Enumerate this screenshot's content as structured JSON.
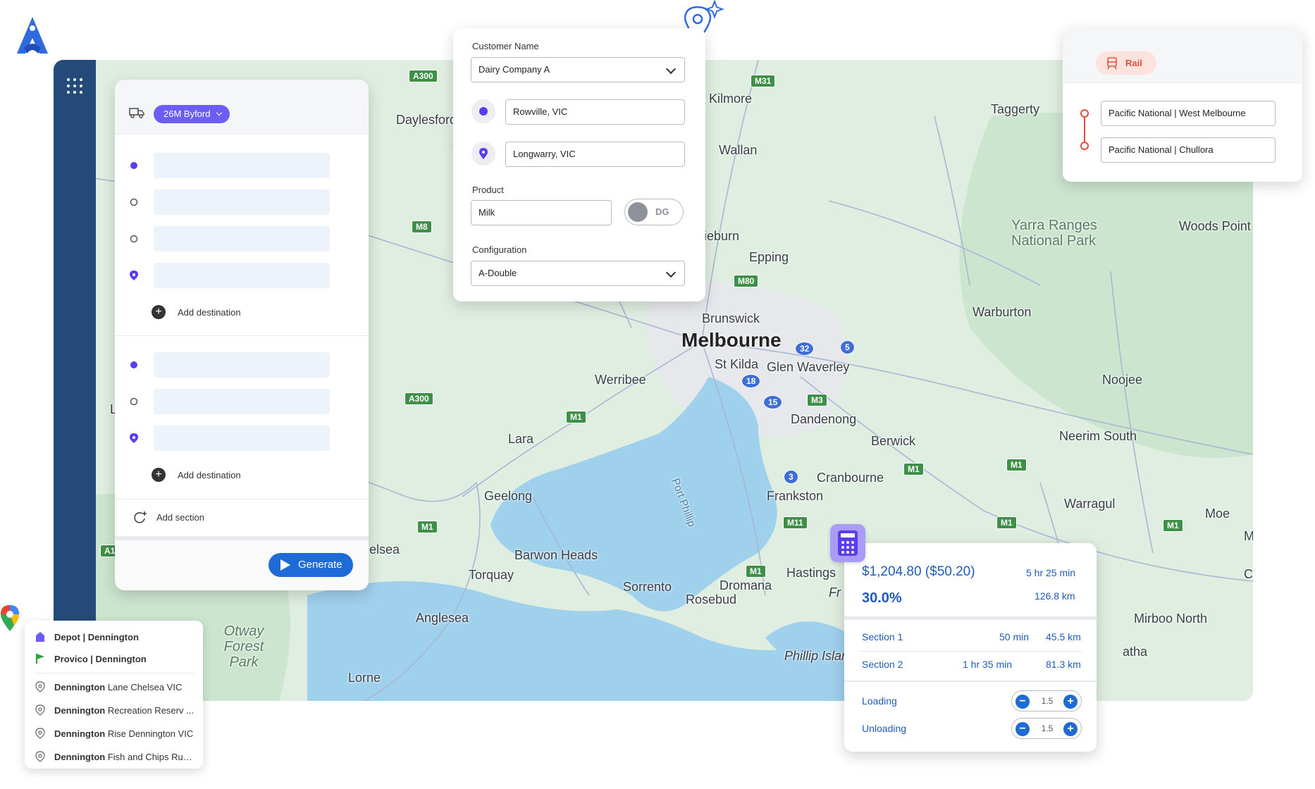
{
  "sidebar": {
    "apps_icon": "grid-dots-icon"
  },
  "route_panel": {
    "vehicle": "26M Byford",
    "add_destination": "Add destination",
    "add_section": "Add section",
    "generate": "Generate"
  },
  "order": {
    "customer_label": "Customer Name",
    "customer_value": "Dairy Company A",
    "origin": "Rowville, VIC",
    "destination": "Longwarry, VIC",
    "product_label": "Product",
    "product_value": "Milk",
    "dg_toggle": "DG",
    "config_label": "Configuration",
    "config_value": "A-Double"
  },
  "rail": {
    "mode": "Rail",
    "from": "Pacific National | West Melbourne",
    "to": "Pacific National | Chullora"
  },
  "results": {
    "cost": "$1,204.80 ($50.20)",
    "duration": "5 hr 25 min",
    "margin": "30.0%",
    "distance": "126.8 km",
    "sections": [
      {
        "name": "Section 1",
        "time": "50 min",
        "distance": "45.5 km"
      },
      {
        "name": "Section 2",
        "time": "1 hr 35 min",
        "distance": "81.3 km"
      }
    ],
    "loading_label": "Loading",
    "loading_value": "1.5",
    "unloading_label": "Unloading",
    "unloading_value": "1.5"
  },
  "places": [
    {
      "bold": "Depot | Dennington",
      "rest": "",
      "icon": "depot-icon"
    },
    {
      "bold": "Provico | Dennington",
      "rest": "",
      "icon": "flag-icon"
    },
    {
      "bold": "Dennington",
      "rest": " Lane Chelsea VIC",
      "icon": "location-pin-icon"
    },
    {
      "bold": "Dennington",
      "rest": " Recreation Reserv ...",
      "icon": "location-pin-icon"
    },
    {
      "bold": "Dennington",
      "rest": " Rise Dennington VIC",
      "icon": "location-pin-icon"
    },
    {
      "bold": "Dennington",
      "rest": " Fish and Chips Rus...",
      "icon": "location-pin-icon"
    }
  ],
  "map": {
    "labels": [
      "Daylesford",
      "Kilmore",
      "Taggerty",
      "Wallan",
      "Yarra Ranges National Park",
      "Woods Point",
      "Epping",
      "ieburn",
      "Brunswick",
      "Melbourne",
      "Warburton",
      "St Kilda",
      "Glen Waverley",
      "Werribee",
      "Noojee",
      "Dandenong",
      "Berwick",
      "Lara",
      "Neerim South",
      "Port Phillip",
      "Cranbourne",
      "Geelong",
      "Frankston",
      "Warragul",
      "Moe",
      "Barwon Heads",
      "Torquay",
      "Sorrento",
      "Dromana",
      "Rosebud",
      "Hastings",
      "Anglesea",
      "Otway Forest Park",
      "Phillip Islar",
      "Mirboo North",
      "atha",
      "Lorne",
      "nelsea",
      "Fr",
      "L",
      "M",
      "C"
    ],
    "shields": [
      "A300",
      "M31",
      "M8",
      "M80",
      "32",
      "5",
      "18",
      "15",
      "M3",
      "A300",
      "M1",
      "M1",
      "M1",
      "3",
      "M1",
      "M1",
      "M1",
      "M11",
      "A1",
      "M1"
    ]
  },
  "colors": {
    "accent": "#1e6bd8",
    "violet": "#6b5df5",
    "sidebar": "#244a7a",
    "rail": "#e0503c",
    "water": "#9fd0ec",
    "land": "#dfeee0"
  }
}
